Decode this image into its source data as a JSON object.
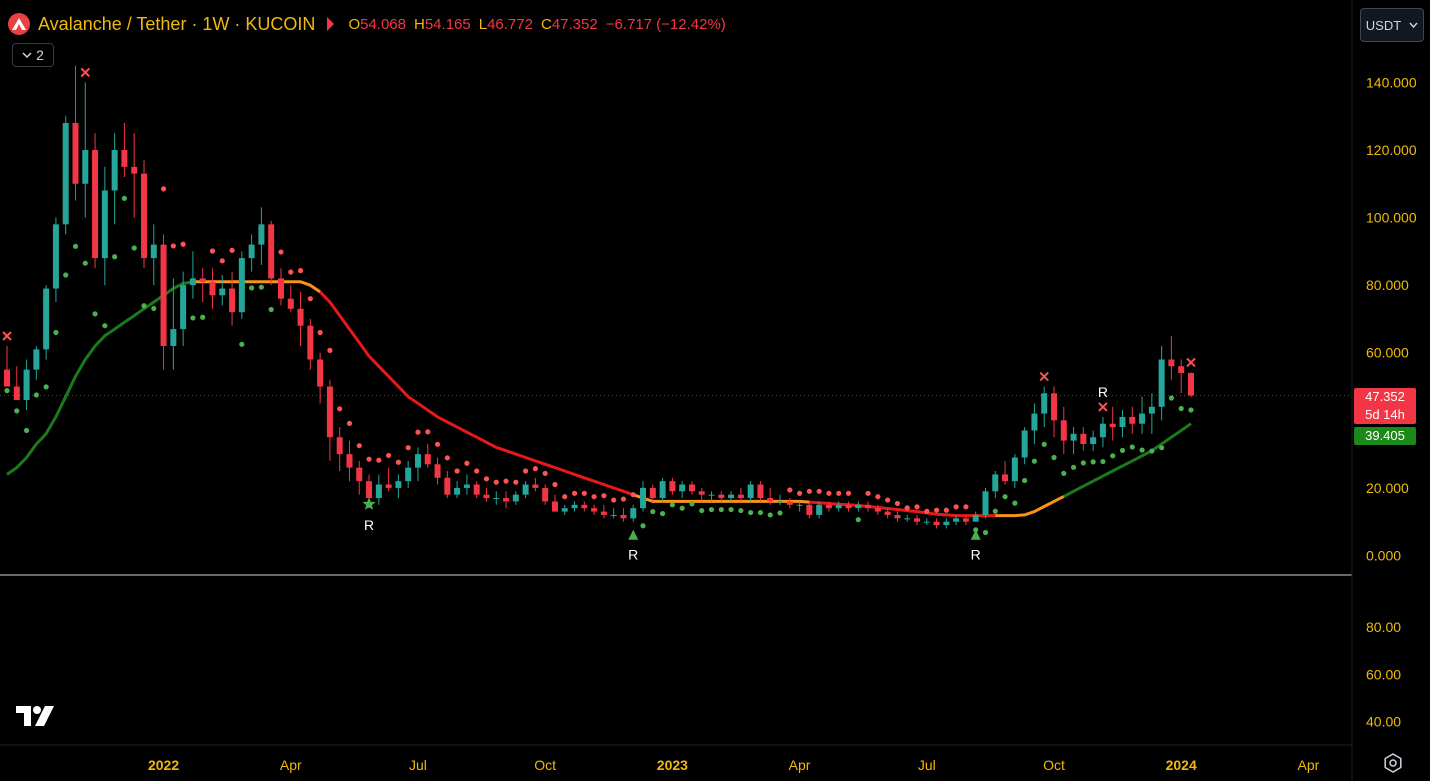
{
  "header": {
    "symbol_title": "Avalanche / Tether · 1W · KUCOIN",
    "ohlc": [
      {
        "k": "O",
        "v": "54.068"
      },
      {
        "k": "H",
        "v": "54.165"
      },
      {
        "k": "L",
        "v": "46.772"
      },
      {
        "k": "C",
        "v": "47.352"
      }
    ],
    "change": "−6.717 (−12.42%)",
    "indicators_count": "2"
  },
  "toolbar": {
    "currency": "USDT"
  },
  "price_axis": {
    "ticks": [
      "140.000",
      "120.000",
      "100.000",
      "80.000",
      "60.000",
      "20.000",
      "0.000"
    ],
    "last_price": "47.352",
    "countdown": "5d 14h",
    "ma_value": "39.405"
  },
  "sub_axis": {
    "ticks": [
      "80.00",
      "60.00",
      "40.00"
    ]
  },
  "time_axis": {
    "labels": [
      "2022",
      "Apr",
      "Jul",
      "Oct",
      "2023",
      "Apr",
      "Jul",
      "Oct",
      "2024",
      "Apr"
    ],
    "bold": [
      true,
      false,
      false,
      false,
      true,
      false,
      false,
      false,
      true,
      false
    ]
  },
  "markers": {
    "signal_label": "R"
  },
  "colors": {
    "up": "#26a69a",
    "down": "#f23645",
    "ma_up": "#1b7a1b",
    "ma_down": "#e61919",
    "ma_flat": "#f7931a",
    "dot_up": "#4caf50",
    "dot_down": "#ff5252",
    "accent": "#f0b90b"
  },
  "chart_data": {
    "type": "candlestick",
    "interval": "1W",
    "y_range": [
      0,
      145
    ],
    "candles": [
      [
        55,
        62,
        53,
        50
      ],
      [
        50,
        56,
        47,
        46
      ],
      [
        46,
        58,
        43,
        55
      ],
      [
        55,
        62,
        52,
        61
      ],
      [
        61,
        80,
        58,
        79
      ],
      [
        79,
        100,
        75,
        98
      ],
      [
        98,
        130,
        95,
        128
      ],
      [
        128,
        145,
        105,
        110
      ],
      [
        110,
        140,
        100,
        120
      ],
      [
        120,
        125,
        85,
        88
      ],
      [
        88,
        115,
        80,
        108
      ],
      [
        108,
        125,
        98,
        120
      ],
      [
        120,
        128,
        112,
        115
      ],
      [
        115,
        125,
        100,
        113
      ],
      [
        113,
        117,
        85,
        88
      ],
      [
        88,
        98,
        80,
        92
      ],
      [
        92,
        95,
        55,
        62
      ],
      [
        62,
        82,
        55,
        67
      ],
      [
        67,
        84,
        62,
        80
      ],
      [
        80,
        90,
        76,
        82
      ],
      [
        82,
        85,
        75,
        81
      ],
      [
        81,
        85,
        73,
        77
      ],
      [
        77,
        83,
        74,
        79
      ],
      [
        79,
        84,
        68,
        72
      ],
      [
        72,
        90,
        70,
        88
      ],
      [
        88,
        95,
        84,
        92
      ],
      [
        92,
        103,
        86,
        98
      ],
      [
        98,
        99,
        80,
        82
      ],
      [
        82,
        85,
        74,
        76
      ],
      [
        76,
        80,
        72,
        73
      ],
      [
        73,
        78,
        62,
        68
      ],
      [
        68,
        70,
        55,
        58
      ],
      [
        58,
        60,
        45,
        50
      ],
      [
        50,
        52,
        28,
        35
      ],
      [
        35,
        38,
        25,
        30
      ],
      [
        30,
        34,
        22,
        26
      ],
      [
        26,
        28,
        18,
        22
      ],
      [
        22,
        24,
        14,
        17
      ],
      [
        17,
        24,
        15,
        21
      ],
      [
        21,
        26,
        19,
        20
      ],
      [
        20,
        24,
        17,
        22
      ],
      [
        22,
        28,
        20,
        26
      ],
      [
        26,
        32,
        22,
        30
      ],
      [
        30,
        33,
        26,
        27
      ],
      [
        27,
        29,
        21,
        23
      ],
      [
        23,
        25,
        17,
        18
      ],
      [
        18,
        22,
        17,
        20
      ],
      [
        20,
        24,
        18,
        21
      ],
      [
        21,
        22,
        17,
        18
      ],
      [
        18,
        20,
        16,
        17
      ],
      [
        17,
        19,
        15,
        17
      ],
      [
        17,
        19,
        14,
        16
      ],
      [
        16,
        19,
        15,
        18
      ],
      [
        18,
        22,
        17,
        21
      ],
      [
        21,
        23,
        19,
        20
      ],
      [
        20,
        21,
        15,
        16
      ],
      [
        16,
        18,
        13,
        13
      ],
      [
        13,
        15,
        12,
        14
      ],
      [
        14,
        16,
        13,
        15
      ],
      [
        15,
        16,
        13,
        14
      ],
      [
        14,
        15,
        12,
        13
      ],
      [
        13,
        15,
        11,
        12
      ],
      [
        12,
        14,
        11,
        12
      ],
      [
        12,
        14,
        10,
        11
      ],
      [
        11,
        15,
        10,
        14
      ],
      [
        14,
        22,
        13,
        20
      ],
      [
        20,
        21,
        16,
        17
      ],
      [
        17,
        23,
        16,
        22
      ],
      [
        22,
        23,
        18,
        19
      ],
      [
        19,
        22,
        17,
        21
      ],
      [
        21,
        22,
        18,
        19
      ],
      [
        19,
        20,
        16,
        18
      ],
      [
        18,
        19,
        16,
        18
      ],
      [
        18,
        19,
        16,
        17
      ],
      [
        17,
        19,
        16,
        18
      ],
      [
        18,
        20,
        16,
        17
      ],
      [
        17,
        22,
        16,
        21
      ],
      [
        21,
        22,
        16,
        17
      ],
      [
        17,
        20,
        15,
        16
      ],
      [
        16,
        18,
        15,
        16
      ],
      [
        16,
        17,
        14,
        15
      ],
      [
        15,
        16,
        13,
        15
      ],
      [
        15,
        16,
        11,
        12
      ],
      [
        12,
        16,
        11,
        15
      ],
      [
        15,
        16,
        13,
        14
      ],
      [
        14,
        16,
        13,
        15
      ],
      [
        15,
        16,
        13,
        14
      ],
      [
        14,
        16,
        13,
        15
      ],
      [
        15,
        16,
        13,
        14
      ],
      [
        14,
        15,
        12,
        13
      ],
      [
        13,
        14,
        11,
        12
      ],
      [
        12,
        13,
        10,
        11
      ],
      [
        11,
        12,
        10,
        11
      ],
      [
        11,
        12,
        9,
        10
      ],
      [
        10,
        11,
        9,
        10
      ],
      [
        10,
        11,
        8,
        9
      ],
      [
        9,
        11,
        8,
        10
      ],
      [
        10,
        12,
        9,
        11
      ],
      [
        11,
        12,
        9,
        10
      ],
      [
        10,
        13,
        10,
        12
      ],
      [
        12,
        20,
        11,
        19
      ],
      [
        19,
        25,
        17,
        24
      ],
      [
        24,
        28,
        21,
        22
      ],
      [
        22,
        30,
        20,
        29
      ],
      [
        29,
        38,
        27,
        37
      ],
      [
        37,
        45,
        33,
        42
      ],
      [
        42,
        50,
        38,
        48
      ],
      [
        48,
        50,
        35,
        40
      ],
      [
        40,
        44,
        30,
        34
      ],
      [
        34,
        38,
        30,
        36
      ],
      [
        36,
        38,
        31,
        33
      ],
      [
        33,
        37,
        31,
        35
      ],
      [
        35,
        41,
        32,
        39
      ],
      [
        39,
        44,
        34,
        38
      ],
      [
        38,
        43,
        35,
        41
      ],
      [
        41,
        44,
        36,
        39
      ],
      [
        39,
        47,
        36,
        42
      ],
      [
        42,
        48,
        36,
        44
      ],
      [
        44,
        62,
        40,
        58
      ],
      [
        58,
        65,
        52,
        56
      ],
      [
        56,
        58,
        48,
        54
      ],
      [
        54,
        54.165,
        46.772,
        47.352
      ]
    ],
    "ma": [
      24,
      26,
      29,
      33,
      36,
      41,
      47,
      53,
      58,
      62,
      65,
      67,
      69,
      71,
      73,
      75,
      77,
      79,
      80.5,
      81,
      81,
      81,
      81,
      81,
      81,
      81,
      81,
      81,
      81,
      81,
      81,
      80,
      78,
      75,
      71,
      67,
      63,
      59,
      56,
      53,
      50,
      47,
      45,
      43,
      41,
      39.5,
      38,
      36.5,
      35,
      33.5,
      32,
      31,
      30,
      29,
      28,
      27,
      26,
      25,
      24,
      23,
      22,
      21,
      20,
      19,
      18,
      17,
      16,
      16,
      16,
      16,
      16,
      16,
      16,
      16,
      16,
      16,
      16,
      16,
      16,
      16,
      16,
      16,
      15.8,
      15.6,
      15.4,
      15.2,
      15,
      14.8,
      14.5,
      14.2,
      13.9,
      13.6,
      13.3,
      13,
      12.6,
      12.2,
      12,
      11.8,
      11.8,
      11.8,
      11.8,
      11.8,
      11.8,
      11.8,
      12,
      13,
      14.5,
      16,
      17.5,
      19,
      20.5,
      22,
      23.5,
      25,
      26.5,
      28,
      29.5,
      31,
      33,
      35,
      37,
      39,
      39.405,
      39.405
    ],
    "ma_segments": [
      {
        "from": 0,
        "to": 19,
        "trend": "up"
      },
      {
        "from": 19,
        "to": 32,
        "trend": "flat"
      },
      {
        "from": 32,
        "to": 64,
        "trend": "down"
      },
      {
        "from": 64,
        "to": 82,
        "trend": "flat"
      },
      {
        "from": 82,
        "to": 101,
        "trend": "down"
      },
      {
        "from": 101,
        "to": 108,
        "trend": "flat"
      },
      {
        "from": 108,
        "to": 121,
        "trend": "up"
      }
    ],
    "signals": [
      {
        "i": 0,
        "type": "sell"
      },
      {
        "i": 8,
        "type": "sell"
      },
      {
        "i": 37,
        "type": "buy_star",
        "label": true
      },
      {
        "i": 64,
        "type": "buy_triangle",
        "label": true
      },
      {
        "i": 99,
        "type": "buy_triangle",
        "label": true
      },
      {
        "i": 106,
        "type": "sell"
      },
      {
        "i": 112,
        "type": "sell",
        "label": true
      },
      {
        "i": 121,
        "type": "sell"
      }
    ],
    "x_axis_label_indices": [
      16,
      29,
      42,
      55,
      68,
      81,
      94,
      107,
      120,
      133
    ],
    "sub_y_range": [
      30,
      100
    ]
  }
}
